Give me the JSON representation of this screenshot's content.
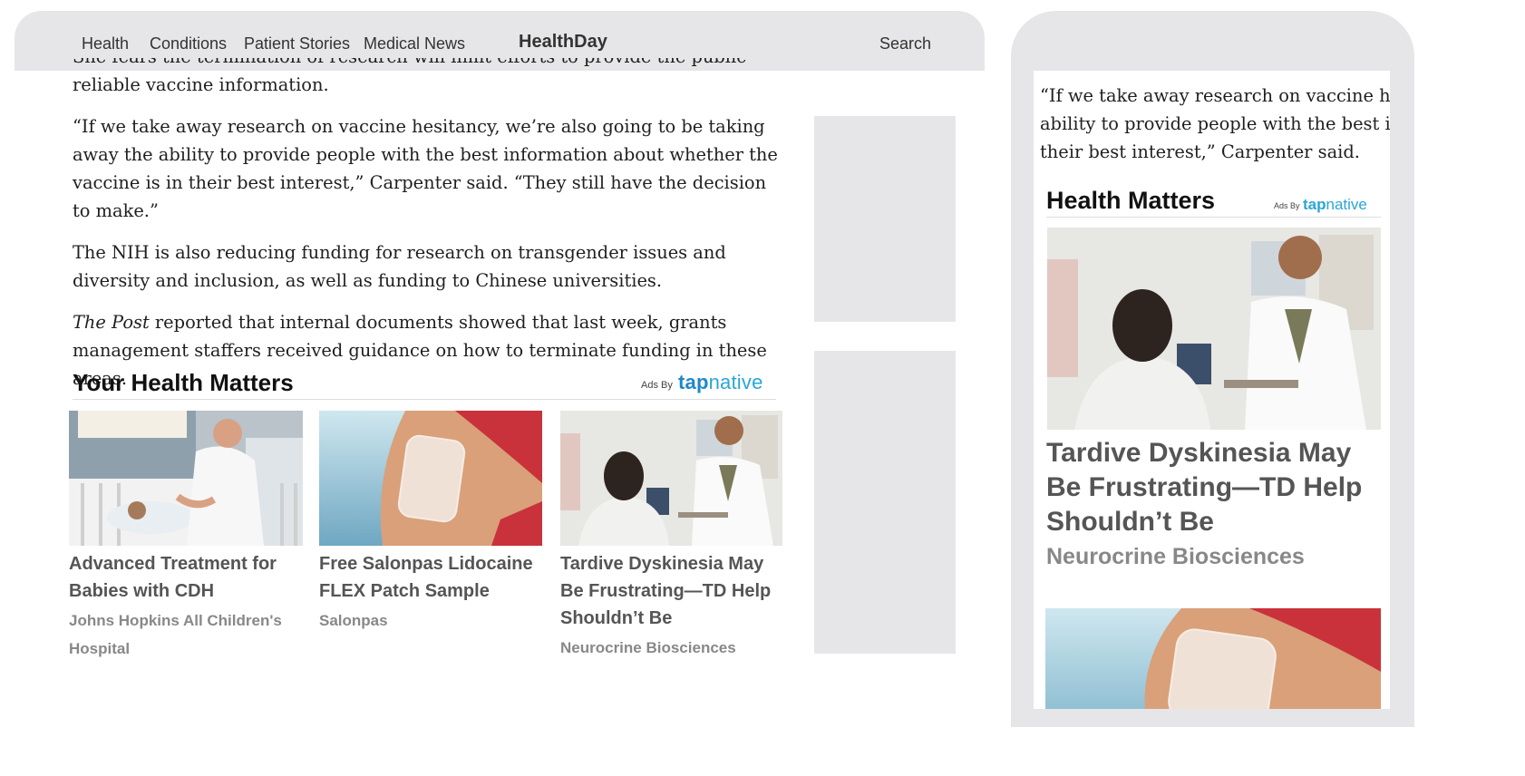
{
  "nav": {
    "items": [
      "Health",
      "Conditions",
      "Patient Stories",
      "Medical News"
    ],
    "brand": "HealthDay",
    "search": "Search"
  },
  "article": {
    "cut_line": "She fears the termination of research will limit efforts to provide the public with",
    "p1_end": "reliable vaccine information.",
    "p2": "“If we take away research on vaccine hesitancy, we’re also going to be taking away the ability to provide people with the best information about whether the vaccine is in their best interest,” Carpenter said. “They still have the decision to make.”",
    "p3": "The NIH is also reducing funding for research on transgender issues and diversity and inclusion, as well as funding to Chinese universities.",
    "p4_italic": "The Post",
    "p4_rest": " reported that internal documents showed that last week, grants management staffers received guidance on how to terminate funding in these areas."
  },
  "widget": {
    "title": "Your Health Matters",
    "ads_by": "Ads By",
    "brand_a": "tap",
    "brand_b": "native",
    "cards": [
      {
        "headline": "Advanced Treatment for Babies with CDH",
        "sponsor": "Johns Hopkins All Children's Hospital"
      },
      {
        "headline": "Free Salonpas Lidocaine FLEX Patch Sample",
        "sponsor": "Salonpas"
      },
      {
        "headline": "Tardive Dyskinesia May Be Frustrating—TD Help Shouldn’t Be",
        "sponsor": "Neurocrine Biosciences"
      }
    ]
  },
  "mobile": {
    "line1": "“If we take away research on vaccine hesit",
    "line2": "ability to provide people with the best info",
    "line3": "their best interest,” Carpenter said.",
    "title": "Health Matters",
    "ads_by": "Ads By",
    "brand_a": "tap",
    "brand_b": "native",
    "headline": "Tardive Dyskinesia May Be Frustrating—TD Help Shouldn’t Be",
    "sponsor": "Neurocrine Biosciences"
  },
  "colors": {
    "frame": "#e6e6e8",
    "tapnative": "#2aa6d8",
    "headline": "#555555",
    "sponsor": "#888888"
  }
}
